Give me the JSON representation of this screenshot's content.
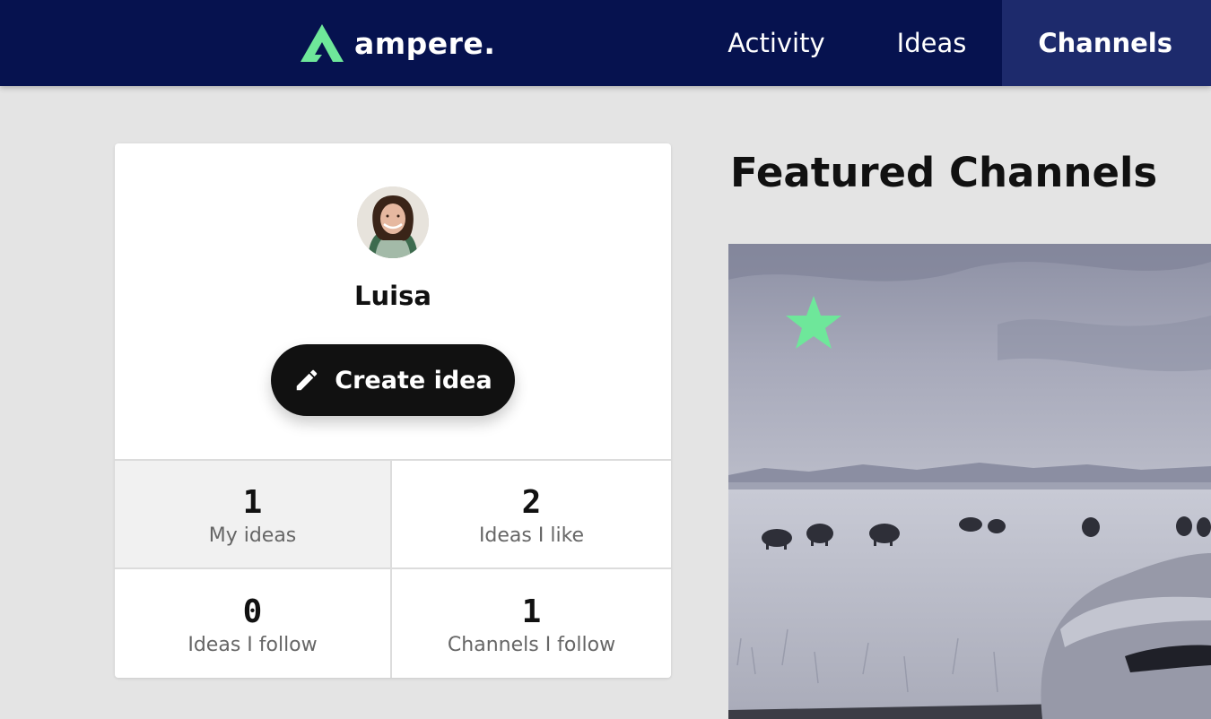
{
  "header": {
    "logo_text": "ampere.",
    "nav": [
      {
        "label": "Activity"
      },
      {
        "label": "Ideas"
      },
      {
        "label": "Channels",
        "active": true
      }
    ],
    "colors": {
      "background": "#06124f",
      "active": "#1d2a6c",
      "accent": "#6ee79a"
    }
  },
  "profile": {
    "name": "Luisa",
    "avatar_icon": "user-photo",
    "create_button_label": "Create idea",
    "stats": [
      {
        "count": "1",
        "label": "My ideas",
        "selected": true
      },
      {
        "count": "2",
        "label": "Ideas I like"
      },
      {
        "count": "0",
        "label": "Ideas I follow"
      },
      {
        "count": "1",
        "label": "Channels I follow"
      }
    ]
  },
  "featured": {
    "title": "Featured Channels",
    "channel_icon": "star-icon"
  }
}
